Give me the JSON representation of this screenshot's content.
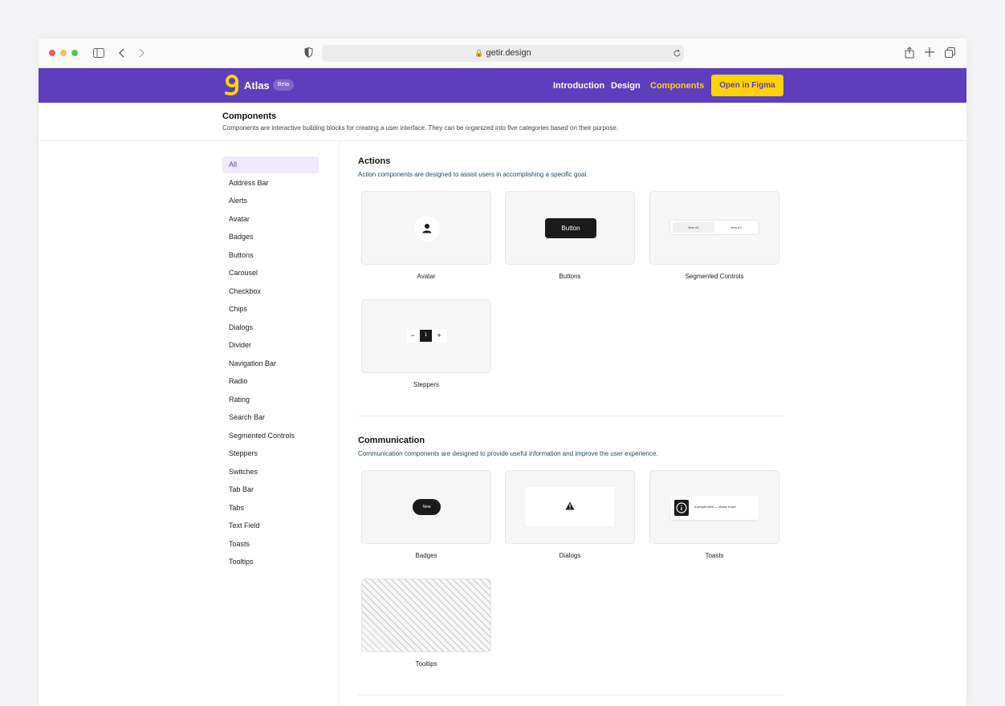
{
  "browser": {
    "url": "getir.design"
  },
  "header": {
    "brand": "Atlas",
    "badge": "Beta",
    "nav": [
      {
        "label": "Introduction"
      },
      {
        "label": "Design"
      },
      {
        "label": "Components"
      }
    ],
    "cta": "Open in Figma",
    "colors": {
      "bar": "#5d3ebc",
      "active": "#ffd300",
      "logo": "#ffd300"
    }
  },
  "intro": {
    "title": "Components",
    "description": "Components are interactive building blocks for creating a user interface. They can be organized into five categories based on their purpose."
  },
  "sidebar": {
    "items": [
      {
        "label": "All"
      },
      {
        "label": "Address Bar"
      },
      {
        "label": "Alerts"
      },
      {
        "label": "Avatar"
      },
      {
        "label": "Badges"
      },
      {
        "label": "Buttons"
      },
      {
        "label": "Carousel"
      },
      {
        "label": "Checkbox"
      },
      {
        "label": "Chips"
      },
      {
        "label": "Dialogs"
      },
      {
        "label": "Divider"
      },
      {
        "label": "Navigation Bar"
      },
      {
        "label": "Radio"
      },
      {
        "label": "Rating"
      },
      {
        "label": "Search Bar"
      },
      {
        "label": "Segmented Controls"
      },
      {
        "label": "Steppers"
      },
      {
        "label": "Switches"
      },
      {
        "label": "Tab Bar"
      },
      {
        "label": "Tabs"
      },
      {
        "label": "Text Field"
      },
      {
        "label": "Toasts"
      },
      {
        "label": "Tooltips"
      }
    ]
  },
  "sections": [
    {
      "title": "Actions",
      "description": "Action components are designed to assist users in accomplishing a specific goal.",
      "cards": [
        {
          "label": "Avatar"
        },
        {
          "label": "Buttons",
          "preview_text": "Button"
        },
        {
          "label": "Segmented Controls",
          "options": [
            "Item #1",
            "Item #2"
          ]
        },
        {
          "label": "Steppers",
          "minus": "−",
          "value": "1",
          "plus": "+"
        }
      ]
    },
    {
      "title": "Communication",
      "description": "Communication components are designed to provide useful information and improve the user experience.",
      "cards": [
        {
          "label": "Badges",
          "preview_text": "New"
        },
        {
          "label": "Dialogs"
        },
        {
          "label": "Toasts",
          "preview_text": "A simple alert — check it out!"
        },
        {
          "label": "Tooltips"
        }
      ]
    }
  ]
}
